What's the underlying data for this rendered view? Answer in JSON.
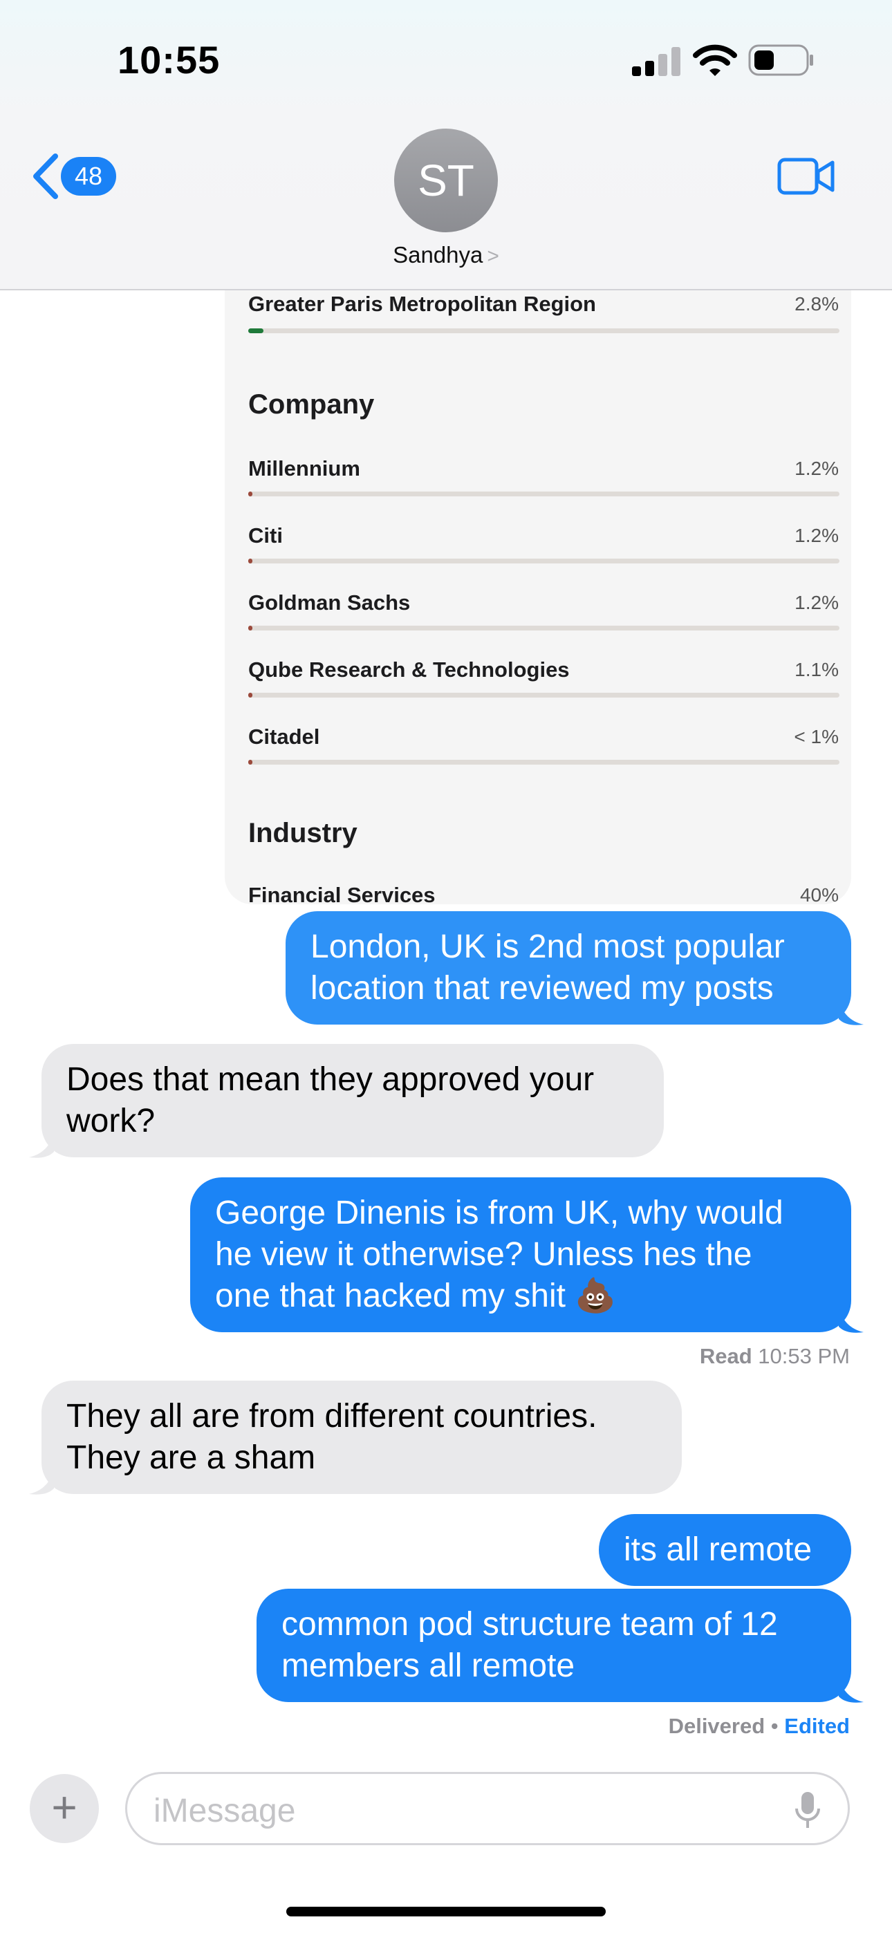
{
  "status_bar": {
    "time": "10:55"
  },
  "header": {
    "back_count": "48",
    "avatar_initials": "ST",
    "contact_name": "Sandhya",
    "contact_chevron": ">"
  },
  "shared_card": {
    "location_row": {
      "label": "Greater Paris Metropolitan Region",
      "value": "2.8%",
      "fill": 0.028,
      "color": "#1f7a3a"
    },
    "company_title": "Company",
    "companies": [
      {
        "label": "Millennium",
        "value": "1.2%",
        "fill": 0.012
      },
      {
        "label": "Citi",
        "value": "1.2%",
        "fill": 0.012
      },
      {
        "label": "Goldman Sachs",
        "value": "1.2%",
        "fill": 0.012
      },
      {
        "label": "Qube Research & Technologies",
        "value": "1.1%",
        "fill": 0.011
      },
      {
        "label": "Citadel",
        "value": "< 1%",
        "fill": 0.009
      }
    ],
    "company_bar_color": "#9b4a3c",
    "industry_title": "Industry",
    "industry_row": {
      "label": "Financial Services",
      "value": "40%"
    }
  },
  "messages": [
    {
      "direction": "outgoing",
      "lines": [
        "London, UK is 2nd most popular",
        "location that reviewed my posts"
      ]
    },
    {
      "direction": "incoming",
      "lines": [
        "Does that mean they approved your",
        "work?"
      ]
    },
    {
      "direction": "outgoing",
      "lines": [
        "George Dinenis is from UK, why would",
        "he view it otherwise? Unless hes the",
        "one that hacked my shit 💩"
      ]
    },
    {
      "direction": "incoming",
      "lines": [
        "They all are from different countries.",
        "They are a sham"
      ]
    },
    {
      "direction": "outgoing",
      "lines": [
        "its all remote"
      ]
    },
    {
      "direction": "outgoing",
      "lines": [
        "common pod structure team of 12",
        "members all remote"
      ]
    }
  ],
  "receipts": {
    "read_label": "Read",
    "read_time": "10:53 PM",
    "delivered_label": "Delivered",
    "separator": "•",
    "edited_label": "Edited"
  },
  "composer": {
    "placeholder": "iMessage",
    "plus": "+"
  },
  "colors": {
    "outgoing_bubble": "#1b84f6",
    "incoming_bubble": "#e9e9eb",
    "accent": "#1a82f6"
  },
  "icons": [
    "back-chevron-icon",
    "video-camera-icon",
    "plus-icon",
    "microphone-icon",
    "signal-icon",
    "wifi-icon",
    "battery-icon"
  ]
}
